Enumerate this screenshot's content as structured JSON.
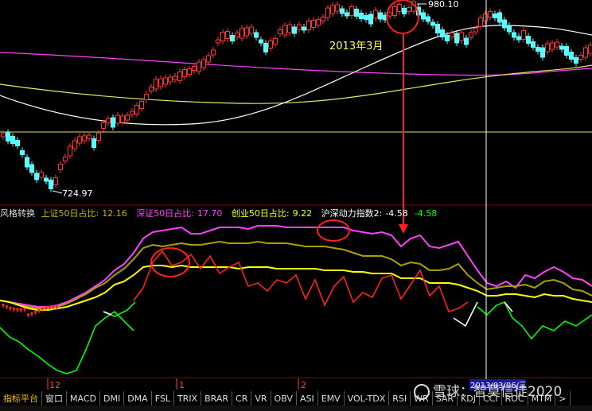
{
  "upper_chart": {
    "high_label": "980.10",
    "low_label": "724.97",
    "annotation": "2013年3月"
  },
  "indicator": {
    "name": "风格转换",
    "series": [
      {
        "label": "上证50日占比:",
        "value": "12.16",
        "color": "#c8b400"
      },
      {
        "label": "深证50日占比:",
        "value": "17.70",
        "color": "#ff40ff"
      },
      {
        "label": "创业50日占比:",
        "value": "9.22",
        "color": "#ffff00"
      },
      {
        "label": "沪深动力指数2:",
        "value": "-4.58",
        "color": "#ffffff"
      },
      {
        "label": "",
        "value": "-4.58",
        "color": "#00ff00"
      }
    ]
  },
  "x_axis": {
    "labels": [
      "12",
      "1",
      "2",
      "2013/03/06/三"
    ]
  },
  "tabs": [
    "指标平台",
    "窗口",
    "MACD",
    "DMI",
    "DMA",
    "FSL",
    "TRIX",
    "BRAR",
    "CR",
    "VR",
    "OBV",
    "ASI",
    "EMV",
    "VOL-TDX",
    "RSI",
    "WR",
    "SAR",
    "KDJ",
    "CCI",
    "ROC",
    "MTM",
    ">"
  ],
  "watermark": {
    "brand": "雪球",
    "handle": "：智莫信徒2020"
  },
  "colors": {
    "background": "#000000",
    "up": "#ff3232",
    "down": "#54ffff",
    "red_arrow": "#ff2020",
    "ma_yellow": "#ffff00",
    "ma_magenta": "#ff40ff"
  }
}
